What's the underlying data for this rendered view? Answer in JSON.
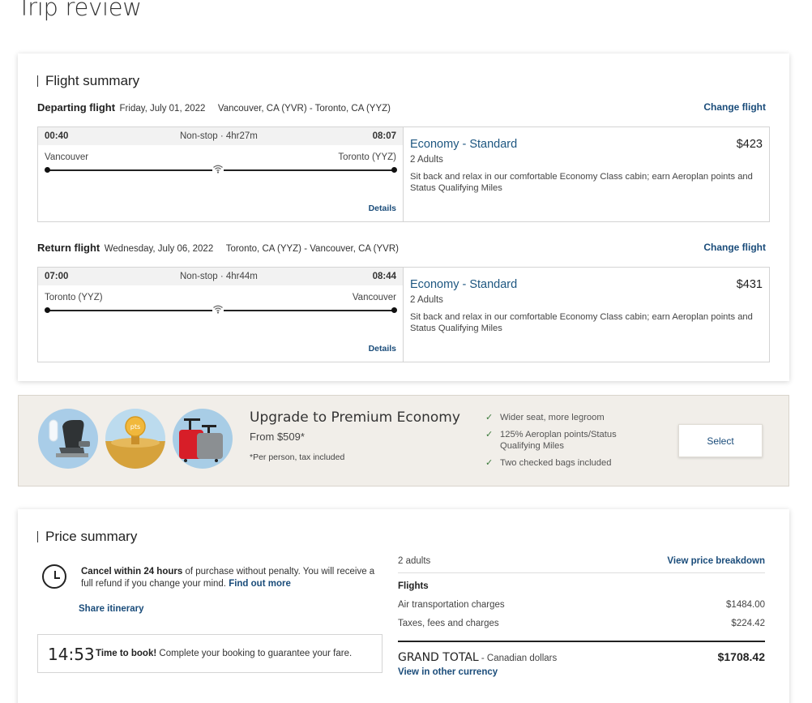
{
  "page": {
    "title": "Trip review"
  },
  "flight_summary": {
    "heading": "Flight summary",
    "legs": [
      {
        "label": "Departing flight",
        "date": "Friday, July 01, 2022",
        "route": "Vancouver, CA (YVR) - Toronto, CA (YYZ)",
        "change_label": "Change flight",
        "dep_time": "00:40",
        "arr_time": "08:07",
        "duration": "Non-stop · 4hr27m",
        "from_city": "Vancouver",
        "to_city": "Toronto (YYZ)",
        "details_label": "Details",
        "cabin": "Economy - Standard",
        "price": "$423",
        "passengers": "2 Adults",
        "description": "Sit back and relax in our comfortable Economy Class cabin; earn Aeroplan points and Status Qualifying Miles"
      },
      {
        "label": "Return flight",
        "date": "Wednesday, July 06, 2022",
        "route": "Toronto, CA (YYZ) - Vancouver, CA (YVR)",
        "change_label": "Change flight",
        "dep_time": "07:00",
        "arr_time": "08:44",
        "duration": "Non-stop · 4hr44m",
        "from_city": "Toronto (YYZ)",
        "to_city": "Vancouver",
        "details_label": "Details",
        "cabin": "Economy - Standard",
        "price": "$431",
        "passengers": "2 Adults",
        "description": "Sit back and relax in our comfortable Economy Class cabin; earn Aeroplan points and Status Qualifying Miles"
      }
    ]
  },
  "upgrade": {
    "title": "Upgrade to Premium Economy",
    "from_price": "From $509*",
    "note": "*Per person, tax included",
    "images": [
      "seat-icon",
      "points-icon",
      "bags-icon"
    ],
    "points_badge": "pts",
    "benefits": [
      "Wider seat, more legroom",
      "125% Aeroplan points/Status Qualifying Miles",
      "Two checked bags included"
    ],
    "select_label": "Select"
  },
  "price_summary": {
    "heading": "Price summary",
    "cancel_bold": "Cancel within 24 hours",
    "cancel_rest": " of purchase without penalty. You will receive a full refund if you change your mind. ",
    "find_out_more": "Find out more",
    "share_itinerary": "Share itinerary",
    "timer": "14:53",
    "timer_bold": "Time to book!",
    "timer_rest": " Complete your booking to guarantee your fare.",
    "passengers": "2 adults",
    "breakdown_label": "View price breakdown",
    "flights_label": "Flights",
    "lines": [
      {
        "label": "Air transportation charges",
        "amount": "$1484.00"
      },
      {
        "label": "Taxes, fees and charges",
        "amount": "$224.42"
      }
    ],
    "grand_total_label": "GRAND TOTAL",
    "grand_total_sub": " - Canadian dollars",
    "grand_total": "$1708.42",
    "other_currency": "View in other currency"
  },
  "colors": {
    "link": "#1a4c7a",
    "banner_bg": "#f1eee9",
    "check": "#3a7a3a"
  }
}
